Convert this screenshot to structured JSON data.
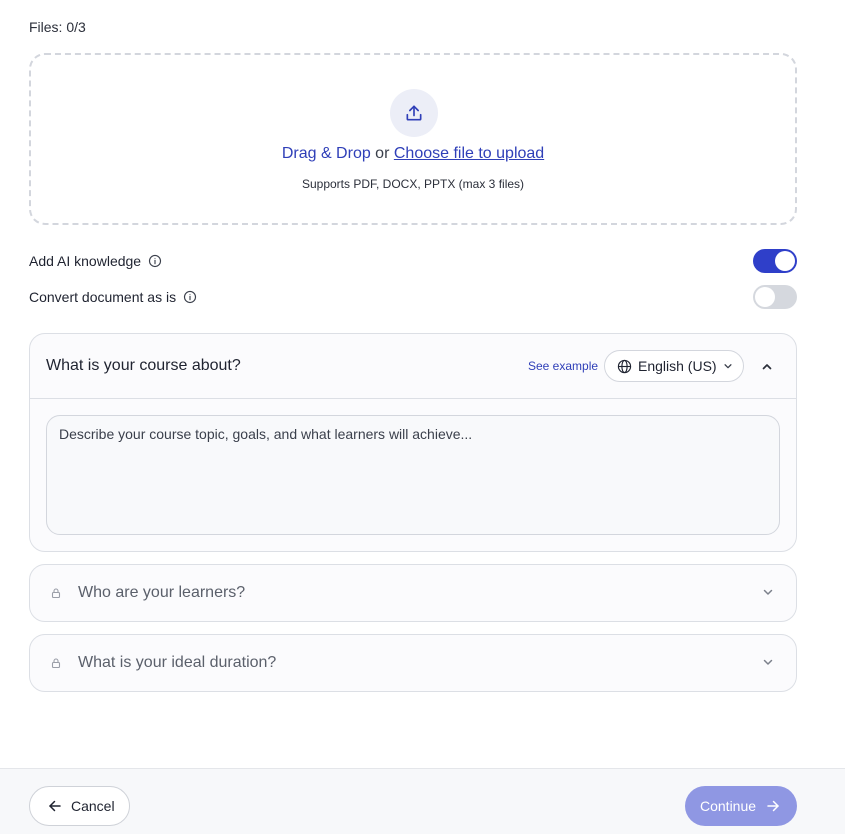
{
  "files": {
    "label": "Files: 0/3"
  },
  "dropzone": {
    "drag_text": "Drag & Drop",
    "or_text": " or ",
    "choose_text": "Choose file to upload",
    "supports_text": "Supports PDF, DOCX, PPTX (max 3 files)",
    "icon": "upload-icon"
  },
  "toggles": [
    {
      "label": "Add AI knowledge",
      "on": true
    },
    {
      "label": "Convert document as is",
      "on": false
    }
  ],
  "course_about": {
    "title": "What is your course about?",
    "see_example": "See example",
    "language": "English (US)",
    "placeholder": "Describe your course topic, goals, and what learners will achieve..."
  },
  "locked_sections": [
    {
      "title": "Who are your learners?"
    },
    {
      "title": "What is your ideal duration?"
    }
  ],
  "footer": {
    "cancel_label": "Cancel",
    "continue_label": "Continue"
  },
  "colors": {
    "accent": "#2f3fc9",
    "link": "#2f3fb8",
    "continue_disabled": "#8f97e3"
  }
}
